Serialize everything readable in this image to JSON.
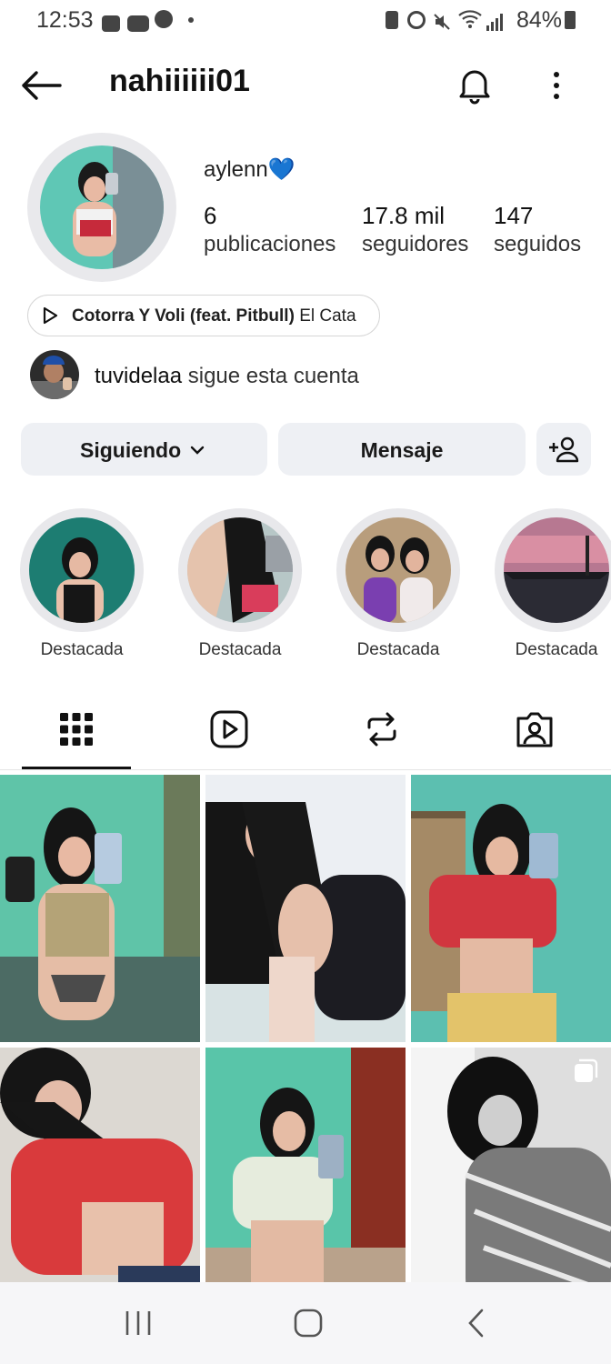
{
  "status_bar": {
    "time": "12:53",
    "battery": "84%",
    "icons": [
      "image-icon",
      "youtube-icon",
      "facebook-icon",
      "dot-icon"
    ],
    "right_icons": [
      "nfc-icon",
      "alarm-icon",
      "mute-icon",
      "wifi-icon",
      "signal-icon",
      "battery-icon"
    ]
  },
  "header": {
    "username": "nahiiiiii01"
  },
  "profile": {
    "display_name": "aylenn",
    "emoji": "💙",
    "stats": [
      {
        "value": "6",
        "label": "publicaciones"
      },
      {
        "value": "17.8 mil",
        "label": "seguidores"
      },
      {
        "value": "147",
        "label": "seguidos"
      }
    ],
    "music": {
      "song": "Cotorra Y Voli (feat. Pitbull)",
      "artist": "El Cata"
    },
    "followed_by": {
      "user": "tuvidelaa",
      "text": "sigue esta cuenta"
    }
  },
  "actions": {
    "following": "Siguiendo",
    "message": "Mensaje"
  },
  "highlights": [
    {
      "label": "Destacada"
    },
    {
      "label": "Destacada"
    },
    {
      "label": "Destacada"
    },
    {
      "label": "Destacada"
    }
  ],
  "tabs": [
    "grid-icon",
    "reels-icon",
    "reposts-icon",
    "tagged-icon"
  ],
  "colors": {
    "accent": "#1877f2",
    "button_bg": "#eef0f4"
  }
}
